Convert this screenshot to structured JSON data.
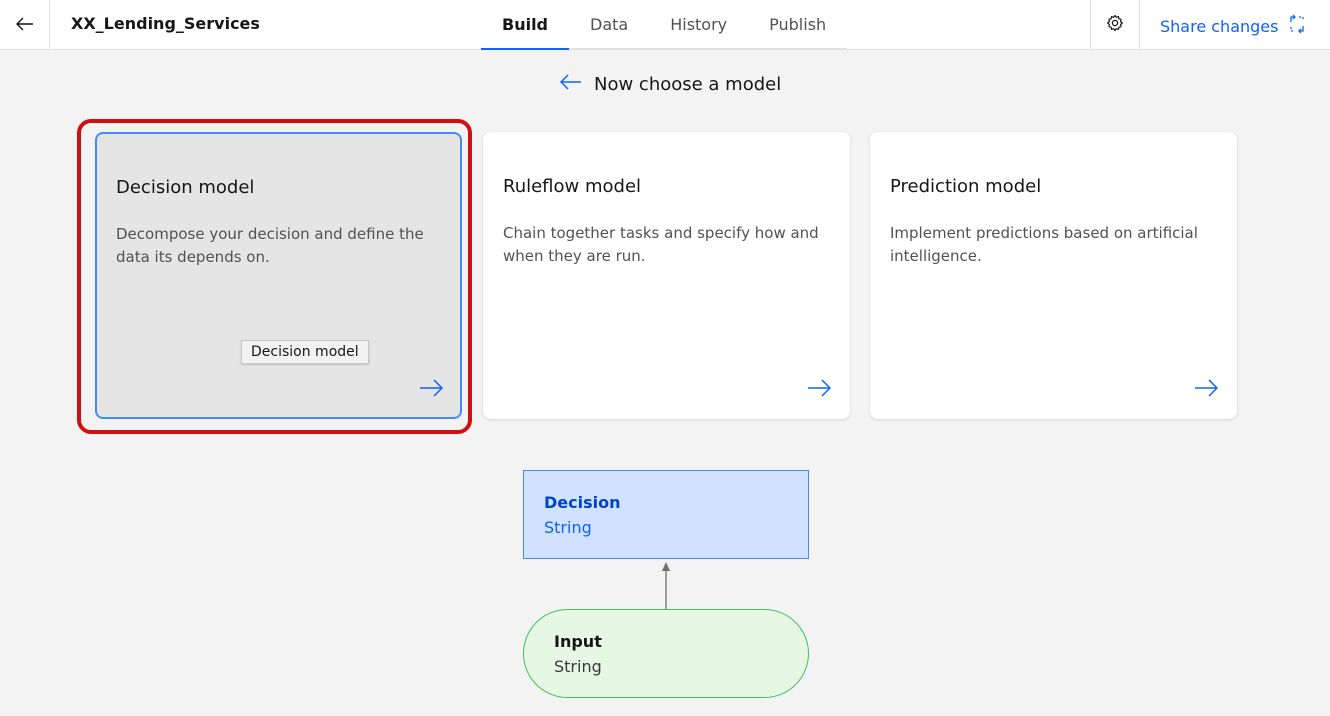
{
  "header": {
    "back_icon": "arrow-left-icon",
    "project_title": "XX_Lending_Services",
    "tabs": [
      {
        "label": "Build",
        "active": true
      },
      {
        "label": "Data",
        "active": false
      },
      {
        "label": "History",
        "active": false
      },
      {
        "label": "Publish",
        "active": false
      }
    ],
    "settings_icon": "gear-icon",
    "share_label": "Share changes",
    "share_icon": "share-sync-icon"
  },
  "prompt": {
    "back_icon": "arrow-left-icon",
    "text": "Now choose a model"
  },
  "cards": [
    {
      "title": "Decision model",
      "description": "Decompose your decision and define the data its depends on.",
      "selected": true,
      "arrow_icon": "arrow-right-icon"
    },
    {
      "title": "Ruleflow model",
      "description": "Chain together tasks and specify how and when they are run.",
      "selected": false,
      "arrow_icon": "arrow-right-icon"
    },
    {
      "title": "Prediction model",
      "description": "Implement predictions based on artificial intelligence.",
      "selected": false,
      "arrow_icon": "arrow-right-icon"
    }
  ],
  "tooltip": {
    "text": "Decision model"
  },
  "diagram": {
    "decision_node": {
      "name": "Decision",
      "type": "String"
    },
    "input_node": {
      "name": "Input",
      "type": "String"
    }
  },
  "colors": {
    "accent": "#0f62fe",
    "highlight": "#d20f0f",
    "decision_fill": "#d0e2ff",
    "input_fill": "#e6f8e4",
    "input_border": "#42be65"
  }
}
